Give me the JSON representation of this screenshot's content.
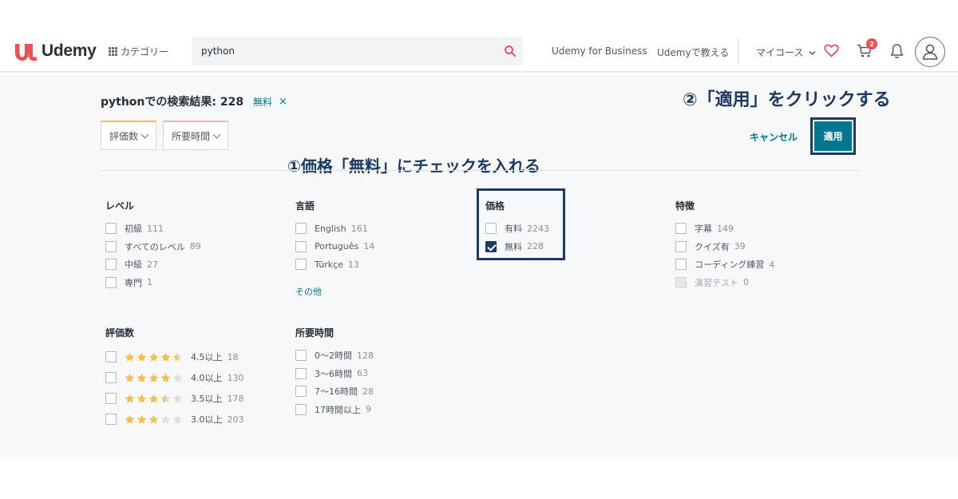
{
  "header": {
    "logo_text": "Udemy",
    "categories_label": "カテゴリー",
    "search": {
      "value": "python",
      "placeholder": ""
    },
    "nav": {
      "business": "Udemy for Business",
      "teach": "Udemyで教える",
      "my_courses": "マイコース"
    },
    "cart_count": "2",
    "brand_color": "#ec5252"
  },
  "results": {
    "title": "pythonでの検索結果: 228",
    "active_tag": "無料",
    "tag_close": "×"
  },
  "annotations": {
    "step1": "①価格「無料」にチェックを入れる",
    "step2": "②「適用」をクリックする"
  },
  "toolbar": {
    "dropdown_rating": "評価数",
    "dropdown_duration": "所要時間",
    "cancel_label": "キャンセル",
    "apply_label": "適用"
  },
  "filters": {
    "level": {
      "title": "レベル",
      "options": [
        {
          "label": "初級",
          "count": "111"
        },
        {
          "label": "すべてのレベル",
          "count": "89"
        },
        {
          "label": "中級",
          "count": "27"
        },
        {
          "label": "専門",
          "count": "1"
        }
      ]
    },
    "language": {
      "title": "言語",
      "options": [
        {
          "label": "English",
          "count": "161"
        },
        {
          "label": "Português",
          "count": "14"
        },
        {
          "label": "Türkçe",
          "count": "13"
        }
      ],
      "more_label": "その他"
    },
    "price": {
      "title": "価格",
      "options": [
        {
          "label": "有料",
          "count": "2243",
          "checked": false
        },
        {
          "label": "無料",
          "count": "228",
          "checked": true
        }
      ]
    },
    "features": {
      "title": "特徴",
      "options": [
        {
          "label": "字幕",
          "count": "149",
          "disabled": false
        },
        {
          "label": "クイズ有",
          "count": "39",
          "disabled": false
        },
        {
          "label": "コーディング練習",
          "count": "4",
          "disabled": false
        },
        {
          "label": "演習テスト",
          "count": "0",
          "disabled": true
        }
      ]
    },
    "rating": {
      "title": "評価数",
      "options": [
        {
          "label": "4.5以上",
          "count": "18",
          "stars": 4.5
        },
        {
          "label": "4.0以上",
          "count": "130",
          "stars": 4.0
        },
        {
          "label": "3.5以上",
          "count": "178",
          "stars": 3.5
        },
        {
          "label": "3.0以上",
          "count": "203",
          "stars": 3.0
        }
      ]
    },
    "duration": {
      "title": "所要時間",
      "options": [
        {
          "label": "0〜2時間",
          "count": "128"
        },
        {
          "label": "3〜6時間",
          "count": "63"
        },
        {
          "label": "7〜16時間",
          "count": "28"
        },
        {
          "label": "17時間以上",
          "count": "9"
        }
      ]
    }
  },
  "colors": {
    "annotation": "#1c3a62",
    "link": "#007791",
    "star": "#f4c150",
    "star_empty": "#dedfe0"
  }
}
